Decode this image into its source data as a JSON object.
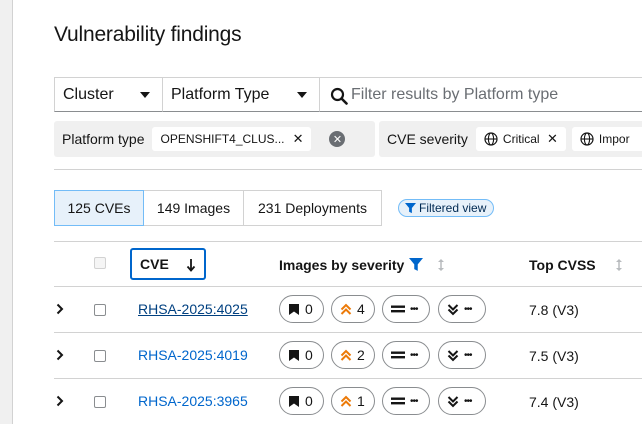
{
  "page": {
    "title": "Vulnerability findings"
  },
  "toolbar": {
    "entity_dropdown": "Cluster",
    "attribute_dropdown": "Platform Type",
    "search_placeholder": "Filter results by Platform type"
  },
  "filters": {
    "platform": {
      "label": "Platform type",
      "chip": "OPENSHIFT4_CLUS..."
    },
    "severity": {
      "label": "CVE severity",
      "chips": [
        "Critical",
        "Impor"
      ]
    }
  },
  "views": {
    "cves": "125 CVEs",
    "images": "149 Images",
    "deployments": "231 Deployments",
    "filtered_badge": "Filtered view"
  },
  "table": {
    "headers": {
      "cve": "CVE",
      "images_by_severity": "Images by severity",
      "top_cvss": "Top CVSS"
    },
    "rows": [
      {
        "cve": "RHSA-2025:4025",
        "critical": "0",
        "important": "4",
        "moderate": "•••",
        "low": "•••",
        "cvss": "7.8 (V3)"
      },
      {
        "cve": "RHSA-2025:4019",
        "critical": "0",
        "important": "2",
        "moderate": "•••",
        "low": "•••",
        "cvss": "7.5 (V3)"
      },
      {
        "cve": "RHSA-2025:3965",
        "critical": "0",
        "important": "1",
        "moderate": "•••",
        "low": "•••",
        "cvss": "7.4 (V3)"
      }
    ]
  },
  "icons": {
    "critical": "critical-severity-icon",
    "important": "important-severity-icon",
    "moderate": "moderate-severity-icon",
    "low": "low-severity-icon"
  },
  "colors": {
    "link": "#0066cc",
    "important": "#ec7a08",
    "selected_bg": "#e7f1fa",
    "filter_icon": "#0066cc"
  }
}
